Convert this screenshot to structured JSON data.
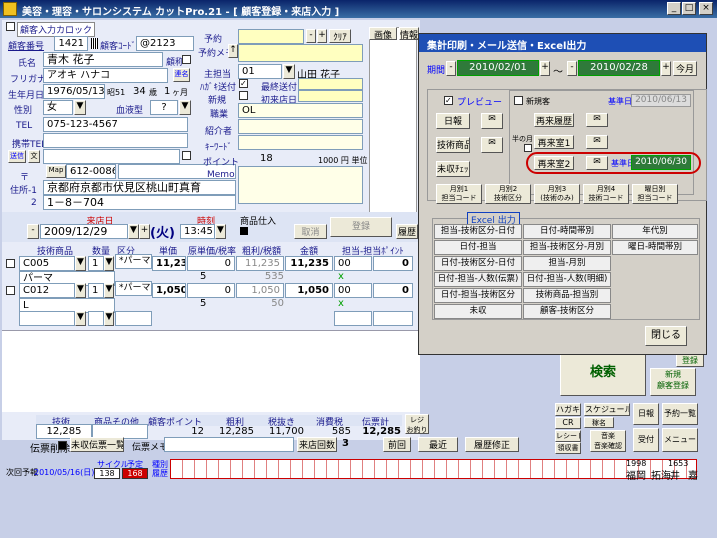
{
  "window": {
    "title": "美容・理容・サロンシステム カットPro.21 - [ 顧客登録・来店入力 ]",
    "buttons": [
      "_",
      "□",
      "×"
    ]
  },
  "customer": {
    "entry_card_label": "顧客入力カロック",
    "number_label": "顧客番号",
    "number": "1421",
    "code_label": "顧客ｺｰﾄﾞ",
    "code": "@2123",
    "name_label": "氏名",
    "name": "青木 花子",
    "kana_label": "フリガナ",
    "kana": "アオキ ハナコ",
    "nickname_label": "顧称",
    "kana_btn": "連名",
    "birth_label": "生年月日",
    "birth": "1976/05/13",
    "era": "昭51",
    "age": "34",
    "age_unit": "歳",
    "months": "1",
    "month_unit": "ヶ月",
    "sex_label": "性別",
    "sex": "女",
    "blood_label": "血液型",
    "blood": "?",
    "tel_label": "TEL",
    "tel": "075-123-4567",
    "mobile_label": "携帯TEL",
    "mail_btn": "送信",
    "mail_btn2": "文",
    "zip_label": "〒",
    "zip_btn": "Map",
    "zip": "612-0086",
    "addr1_label": "住所-1",
    "addr1": "京都府京都市伏見区桃山町真育",
    "addr2_label": "2",
    "addr2": "1－8－704"
  },
  "right_info": {
    "yoyaku_label": "予約",
    "yoyaku_memo_label": "予約メモ",
    "main_staff_label": "主担当",
    "main_staff_code": "01",
    "main_staff_name": "山田 花子",
    "dm_label": "ﾊｶﾞｷ送付",
    "last_send_label": "最終送付",
    "new_label": "新規",
    "first_visit_label": "初来店日",
    "job_label": "職業",
    "job": "OL",
    "intro_label": "紹介者",
    "keyword_label": "ｷｰﾜｰﾄﾞ",
    "point_label": "ポイント",
    "point": "18",
    "point_unit": "1000 円 単位",
    "memo_label": "Memo",
    "clear_btn": "ｸﾘｱ"
  },
  "tabs": [
    "画像",
    "情報",
    "経歴",
    "ｽﾀｲﾙ",
    "シート"
  ],
  "visit": {
    "date_label": "来店日",
    "date": "2009/12/29",
    "weekday": "(火)",
    "time_label": "時刻",
    "time": "13:45",
    "goods_label": "商品仕入",
    "register_btn": "登録",
    "cancel_btn": "取消",
    "history_btn": "履歴"
  },
  "lines": {
    "headers": [
      "技術商品",
      "数量",
      "区分",
      "単価",
      "原単価/税率",
      "粗利/税額",
      "金額",
      "担当-担当ﾎﾟｲﾝﾄ"
    ],
    "rows": [
      {
        "code": "C005",
        "qty": "1",
        "kubun": "*パーマ",
        "price": "11,235",
        "orig": "0",
        "gross": "11,235",
        "amount": "11,235",
        "staff": "00",
        "pt": "0",
        "name": "パーマ",
        "tax_rate": "5",
        "tax": "535",
        "mark": "x"
      },
      {
        "code": "C012",
        "qty": "1",
        "kubun": "*パーマ",
        "price": "1,050",
        "orig": "0",
        "gross": "1,050",
        "amount": "1,050",
        "staff": "00",
        "pt": "0",
        "name": "L",
        "tax_rate": "5",
        "tax": "50",
        "mark": "x"
      }
    ]
  },
  "totals": {
    "headers": [
      "技術",
      "商品その他",
      "顧客ポイント",
      "粗利",
      "税抜き",
      "消費税",
      "伝票計",
      "レジ"
    ],
    "reji_sub": "お釣り",
    "values": [
      "12,285",
      "",
      "12",
      "12,285",
      "11,700",
      "585",
      "12,285"
    ],
    "delete_label": "伝票削除",
    "unpaid_btn": "未収伝票一覧",
    "memo_label": "伝票メモ",
    "visits_label": "来店回数",
    "visits": "3",
    "prev_btn": "前回",
    "latest_btn": "最近",
    "fix_btn": "履歴修正"
  },
  "bottom": {
    "next_label": "次回予報",
    "next_date": "2010/05/16(日)",
    "cycle_label": "サイクル",
    "cycle_val": "138",
    "plan_label": "予定",
    "plan_val": "168",
    "kind_label": "種別",
    "kind_val": "履歴",
    "year1": "1998",
    "year2": "1653",
    "location": "福岡",
    "staff_short": "拓海",
    "staff_short2": "井",
    "staff_short3": "嘉"
  },
  "side_buttons": {
    "search": "検索",
    "new_reg1": "新規",
    "new_reg2": "顧客登録",
    "reg_top": "登録",
    "hagaki": "ハガキ",
    "schedule": "スケジュール",
    "sched_sub": "稼名",
    "cr": "CR",
    "daily": "日報",
    "yoyaku_list": "予約一覧",
    "receipt": "レシート",
    "ryoshu": "領収書",
    "music": "音楽",
    "confirm": "音楽確認",
    "accept": "受付",
    "menu": "メニュー"
  },
  "dialog": {
    "title": "集計印刷・メール送信・Excel出力",
    "period_label": "期間",
    "from": "2010/02/01",
    "to": "2010/02/28",
    "tilde": "～",
    "this_month": "今月",
    "preview_label": "プレビュー",
    "new_cust_label": "新規客",
    "base_date_label": "基準日",
    "base_date1": "2010/06/13",
    "daily_btn": "日報",
    "tech_btn": "技術商品",
    "unpaid_btn": "未収ﾁｪｯｸ",
    "repeat_hist": "再来履歴",
    "repeat1": "再来室1",
    "repeat2": "再来室2",
    "month_label": "半の月",
    "base_date2": "2010/06/30",
    "monthly_btns": [
      "月別1\n担当コード",
      "月別2\n技術区分",
      "月別3\n(技術のみ)",
      "月別4\n技術コード",
      "曜日別\n担当コード"
    ],
    "excel_title": "Excel 出力",
    "excel_btns": [
      [
        "担当-技術区分-日付",
        "日付-時間帯別",
        "年代別"
      ],
      [
        "日付-担当",
        "担当-技術区分-月別",
        "曜日-時間帯別"
      ],
      [
        "日付-技術区分-日付",
        "担当-月別",
        ""
      ],
      [
        "日付-担当-人数(伝票)",
        "日付-担当-人数(明細)",
        ""
      ],
      [
        "日付-担当-技術区分",
        "技術商品-担当別",
        ""
      ],
      [
        "未収",
        "顧客-技術区分",
        ""
      ]
    ],
    "close_btn": "閉じる"
  },
  "colors": {
    "title_bar": "#0a246a",
    "dialog_title": "#1e4fb5",
    "field_green": "#2f7a3a",
    "highlight_red": "#cc0000",
    "yellow_field": "#ffffc0"
  }
}
